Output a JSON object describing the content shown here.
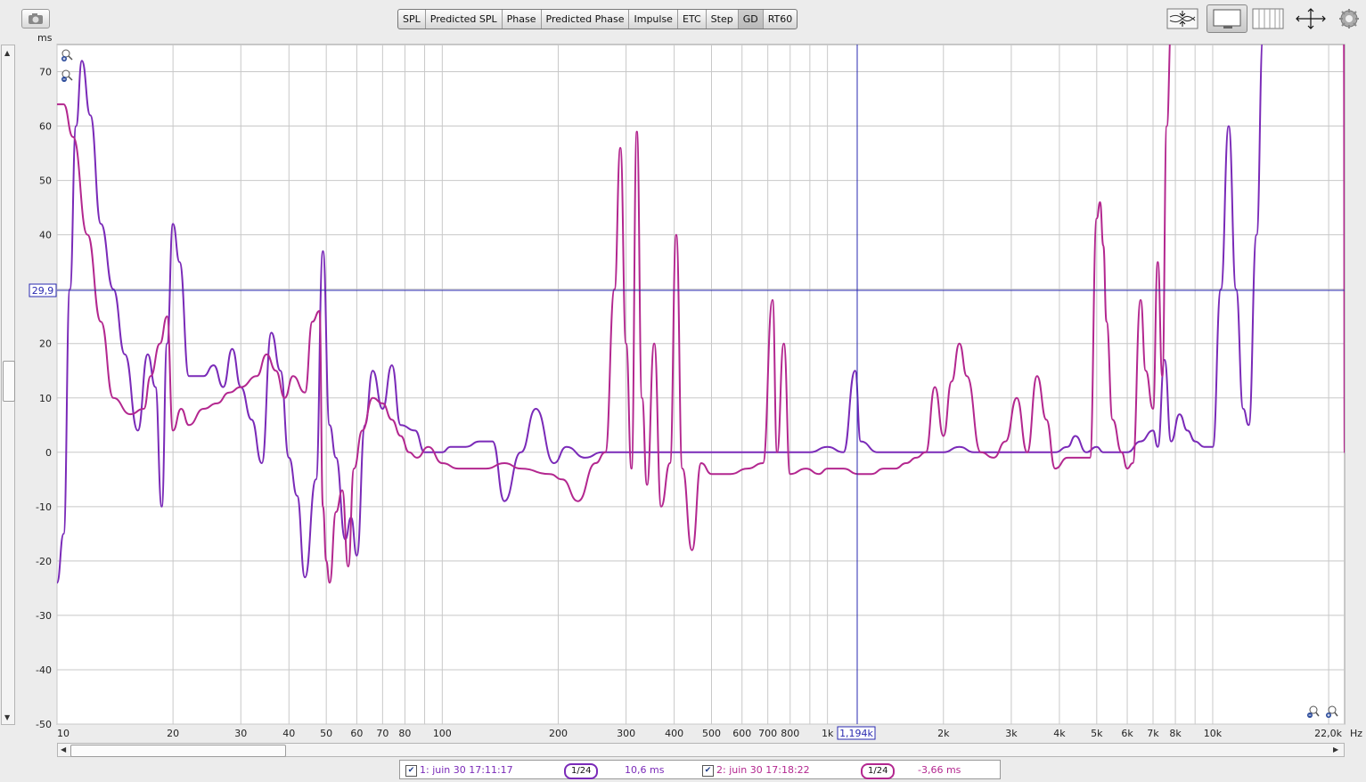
{
  "tabs": [
    "SPL",
    "Predicted SPL",
    "Phase",
    "Predicted Phase",
    "Impulse",
    "ETC",
    "Step",
    "GD",
    "RT60"
  ],
  "active_tab": "GD",
  "toolbar_icons": [
    "compress-vertical-icon",
    "full-graph-icon",
    "grid-lines-icon",
    "expand-arrows-icon",
    "settings-gear-icon"
  ],
  "chart": {
    "y_unit": "ms",
    "x_unit": "Hz",
    "y_ticks": [
      "70",
      "60",
      "50",
      "40",
      "30",
      "20",
      "10",
      "0",
      "-10",
      "-20",
      "-30",
      "-40",
      "-50"
    ],
    "x_labels": [
      "10",
      "20",
      "30",
      "40",
      "50",
      "60",
      "70",
      "80",
      "100",
      "200",
      "300",
      "400",
      "500",
      "600",
      "700",
      "800",
      "1k",
      "2k",
      "3k",
      "4k",
      "5k",
      "6k",
      "7k",
      "8k",
      "10k",
      "22,0k"
    ],
    "cursor": {
      "y_readout": "29,9",
      "x_readout": "1,194k"
    }
  },
  "chart_data": {
    "type": "line",
    "x_scale": "log",
    "xlim": [
      10,
      22000
    ],
    "ylim": [
      -50,
      75
    ],
    "xlabel": "Hz",
    "ylabel": "ms",
    "grid": true,
    "series": [
      {
        "name": "1: juin 30 17:11:17",
        "color": "#7a2ab8",
        "points": [
          [
            10,
            -24
          ],
          [
            10.4,
            -15
          ],
          [
            10.8,
            30
          ],
          [
            11.2,
            60
          ],
          [
            11.6,
            72
          ],
          [
            12.2,
            62
          ],
          [
            13,
            42
          ],
          [
            14,
            30
          ],
          [
            15,
            18
          ],
          [
            16.2,
            4
          ],
          [
            17.2,
            18
          ],
          [
            18,
            12
          ],
          [
            18.7,
            -10
          ],
          [
            19.3,
            20
          ],
          [
            20,
            42
          ],
          [
            20.8,
            35
          ],
          [
            22,
            14
          ],
          [
            24,
            14
          ],
          [
            25.5,
            16
          ],
          [
            27,
            12
          ],
          [
            28.5,
            19
          ],
          [
            30,
            12
          ],
          [
            32,
            6
          ],
          [
            34,
            -2
          ],
          [
            36,
            22
          ],
          [
            38,
            15
          ],
          [
            40,
            -1
          ],
          [
            42,
            -8
          ],
          [
            44,
            -23
          ],
          [
            47,
            -5
          ],
          [
            49,
            37
          ],
          [
            51,
            5
          ],
          [
            53,
            -1
          ],
          [
            56,
            -16
          ],
          [
            58,
            -12
          ],
          [
            60,
            -19
          ],
          [
            63,
            5
          ],
          [
            66,
            15
          ],
          [
            70,
            8
          ],
          [
            74,
            16
          ],
          [
            78,
            5
          ],
          [
            85,
            4
          ],
          [
            90,
            0
          ],
          [
            100,
            0
          ],
          [
            105,
            1
          ],
          [
            115,
            1
          ],
          [
            125,
            2
          ],
          [
            135,
            2
          ],
          [
            145,
            -9
          ],
          [
            160,
            0
          ],
          [
            175,
            8
          ],
          [
            195,
            -2
          ],
          [
            210,
            1
          ],
          [
            235,
            -1
          ],
          [
            260,
            0
          ],
          [
            290,
            0
          ],
          [
            320,
            0
          ],
          [
            370,
            0
          ],
          [
            420,
            0
          ],
          [
            480,
            0
          ],
          [
            550,
            0
          ],
          [
            620,
            0
          ],
          [
            700,
            0
          ],
          [
            800,
            0
          ],
          [
            900,
            0
          ],
          [
            1000,
            1
          ],
          [
            1100,
            0
          ],
          [
            1180,
            15
          ],
          [
            1220,
            2
          ],
          [
            1350,
            0
          ],
          [
            1600,
            0
          ],
          [
            1800,
            0
          ],
          [
            2000,
            0
          ],
          [
            2200,
            1
          ],
          [
            2400,
            0
          ],
          [
            2600,
            0
          ],
          [
            2900,
            0
          ],
          [
            3200,
            0
          ],
          [
            3500,
            0
          ],
          [
            3900,
            0
          ],
          [
            4200,
            1
          ],
          [
            4400,
            3
          ],
          [
            4700,
            0
          ],
          [
            5000,
            1
          ],
          [
            5200,
            0
          ],
          [
            5600,
            0
          ],
          [
            6000,
            0
          ],
          [
            6500,
            2
          ],
          [
            7000,
            4
          ],
          [
            7200,
            1
          ],
          [
            7500,
            17
          ],
          [
            7800,
            2
          ],
          [
            8200,
            7
          ],
          [
            8600,
            4
          ],
          [
            9000,
            2
          ],
          [
            9500,
            1
          ],
          [
            10000,
            1
          ],
          [
            10500,
            30
          ],
          [
            11000,
            60
          ],
          [
            11500,
            30
          ],
          [
            12000,
            8
          ],
          [
            12400,
            5
          ],
          [
            13000,
            40
          ],
          [
            13500,
            76
          ]
        ]
      },
      {
        "name": "2: juin 30 17:18:22",
        "color": "#b3278f",
        "points": [
          [
            10,
            64
          ],
          [
            10.4,
            64
          ],
          [
            11,
            58
          ],
          [
            12,
            40
          ],
          [
            13,
            24
          ],
          [
            14,
            10
          ],
          [
            15.5,
            7
          ],
          [
            16.8,
            8
          ],
          [
            17.5,
            14
          ],
          [
            18.5,
            20
          ],
          [
            19.3,
            25
          ],
          [
            20,
            4
          ],
          [
            21,
            8
          ],
          [
            22,
            5
          ],
          [
            24,
            8
          ],
          [
            26,
            9
          ],
          [
            28,
            11
          ],
          [
            30,
            12
          ],
          [
            33,
            14
          ],
          [
            35,
            18
          ],
          [
            37,
            15
          ],
          [
            39,
            10
          ],
          [
            41,
            14
          ],
          [
            44,
            11
          ],
          [
            46,
            24
          ],
          [
            48,
            26
          ],
          [
            49,
            -10
          ],
          [
            50,
            -20
          ],
          [
            51,
            -24
          ],
          [
            53,
            -11
          ],
          [
            55,
            -7
          ],
          [
            57,
            -21
          ],
          [
            59,
            -3
          ],
          [
            62,
            4
          ],
          [
            66,
            10
          ],
          [
            70,
            9
          ],
          [
            74,
            6
          ],
          [
            78,
            3
          ],
          [
            82,
            0
          ],
          [
            86,
            -1
          ],
          [
            92,
            1
          ],
          [
            100,
            -2
          ],
          [
            110,
            -3
          ],
          [
            130,
            -3
          ],
          [
            145,
            -2
          ],
          [
            160,
            -3
          ],
          [
            190,
            -4
          ],
          [
            205,
            -5
          ],
          [
            225,
            -9
          ],
          [
            250,
            -2
          ],
          [
            265,
            0
          ],
          [
            280,
            30
          ],
          [
            290,
            56
          ],
          [
            300,
            20
          ],
          [
            310,
            -3
          ],
          [
            320,
            59
          ],
          [
            330,
            10
          ],
          [
            340,
            -6
          ],
          [
            355,
            20
          ],
          [
            370,
            -10
          ],
          [
            390,
            -2
          ],
          [
            405,
            40
          ],
          [
            420,
            -3
          ],
          [
            445,
            -18
          ],
          [
            470,
            -2
          ],
          [
            500,
            -4
          ],
          [
            560,
            -4
          ],
          [
            620,
            -3
          ],
          [
            680,
            -2
          ],
          [
            720,
            28
          ],
          [
            740,
            0
          ],
          [
            770,
            20
          ],
          [
            800,
            -4
          ],
          [
            880,
            -3
          ],
          [
            950,
            -4
          ],
          [
            1000,
            -3
          ],
          [
            1100,
            -3
          ],
          [
            1200,
            -4
          ],
          [
            1300,
            -4
          ],
          [
            1400,
            -3
          ],
          [
            1500,
            -3
          ],
          [
            1600,
            -2
          ],
          [
            1700,
            -1
          ],
          [
            1800,
            0
          ],
          [
            1900,
            12
          ],
          [
            2000,
            3
          ],
          [
            2100,
            13
          ],
          [
            2200,
            20
          ],
          [
            2300,
            14
          ],
          [
            2500,
            0
          ],
          [
            2700,
            -1
          ],
          [
            2900,
            2
          ],
          [
            3100,
            10
          ],
          [
            3300,
            0
          ],
          [
            3500,
            14
          ],
          [
            3700,
            6
          ],
          [
            3900,
            -3
          ],
          [
            4200,
            -1
          ],
          [
            4600,
            -1
          ],
          [
            4800,
            -1
          ],
          [
            5000,
            43
          ],
          [
            5100,
            46
          ],
          [
            5200,
            38
          ],
          [
            5300,
            24
          ],
          [
            5500,
            6
          ],
          [
            5800,
            0
          ],
          [
            6000,
            -3
          ],
          [
            6200,
            -2
          ],
          [
            6500,
            28
          ],
          [
            6700,
            15
          ],
          [
            7000,
            8
          ],
          [
            7200,
            35
          ],
          [
            7400,
            14
          ],
          [
            7600,
            60
          ],
          [
            7800,
            78
          ],
          [
            8000,
            78
          ],
          [
            9000,
            78
          ],
          [
            10000,
            78
          ],
          [
            12000,
            78
          ],
          [
            14000,
            78
          ],
          [
            18000,
            78
          ],
          [
            21900,
            78
          ],
          [
            22000,
            0
          ]
        ]
      }
    ]
  },
  "legend": {
    "entry1": {
      "label": "1: juin 30 17:11:17",
      "smoothing": "1/24",
      "value": "10,6 ms"
    },
    "entry2": {
      "label": "2: juin 30 17:18:22",
      "smoothing": "1/24",
      "value": "-3,66 ms"
    }
  },
  "colors": {
    "trace1": "#7a2ab8",
    "trace2": "#b3278f",
    "cursor": "#2a2ab0",
    "grid": "#c8c8c8"
  }
}
